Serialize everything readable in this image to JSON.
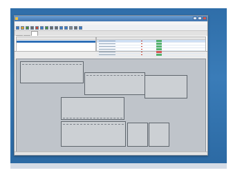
{
  "window": {
    "title": "",
    "menu": [
      "",
      "",
      "",
      "",
      "",
      ""
    ]
  },
  "toolbar": {
    "icons": [
      "new-icon",
      "open-icon",
      "save-icon",
      "print-icon",
      "cut-icon",
      "copy-icon",
      "paste-icon",
      "undo-icon",
      "redo-icon",
      "zoom-in-icon",
      "zoom-out-icon",
      "grid-icon",
      "settings-icon",
      "help-icon"
    ]
  },
  "tabs": [
    {
      "label": "",
      "active": false
    },
    {
      "label": "",
      "active": false
    },
    {
      "label": "",
      "active": true
    }
  ],
  "colors": {
    "frame_blue": "#3a7cb8",
    "selection_blue": "#2e6fb7",
    "status_green": "#3aa655",
    "status_red": "#d23b3b"
  },
  "right_list": {
    "row_status_colors": [
      "#3aa655",
      "#3aa655",
      "#3aa655",
      "#3aa655",
      "#d23b3b",
      "#3aa655"
    ]
  }
}
